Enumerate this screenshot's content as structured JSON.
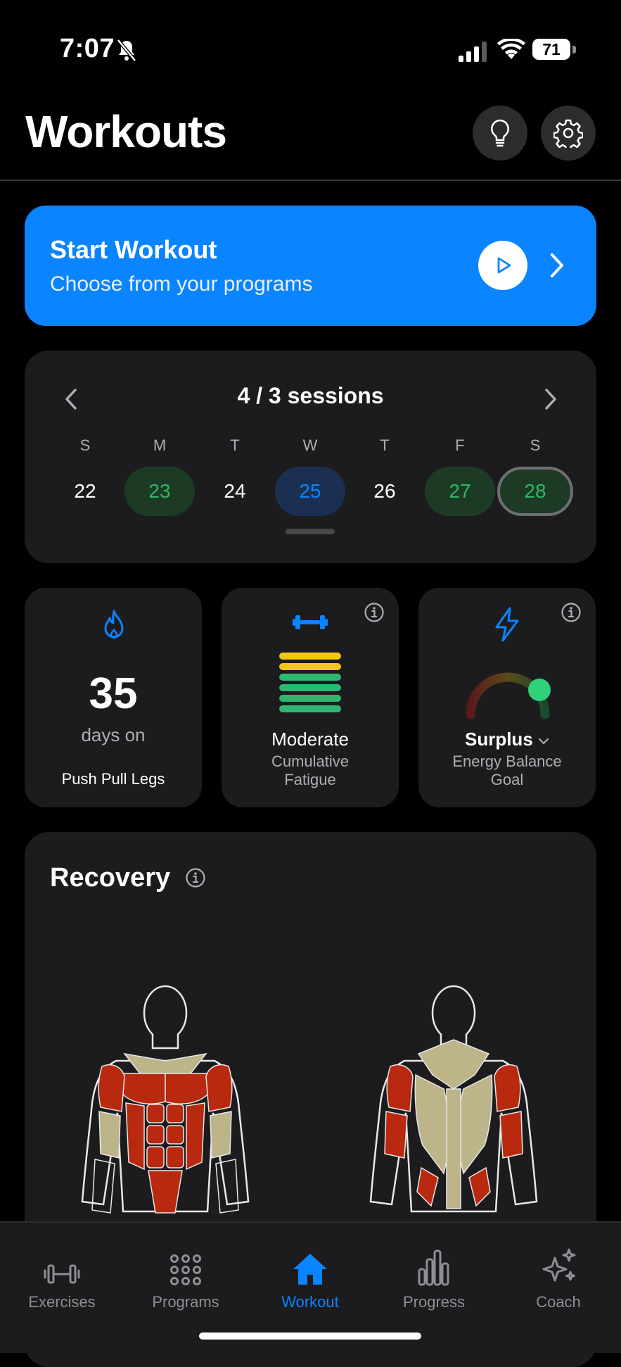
{
  "status": {
    "time": "7:07",
    "battery": "71"
  },
  "header": {
    "title": "Workouts"
  },
  "start_workout": {
    "title": "Start Workout",
    "subtitle": "Choose from your programs"
  },
  "calendar": {
    "title": "4 / 3 sessions",
    "weekdays": [
      "S",
      "M",
      "T",
      "W",
      "T",
      "F",
      "S"
    ],
    "days": [
      {
        "num": "22",
        "state": "none"
      },
      {
        "num": "23",
        "state": "completed"
      },
      {
        "num": "24",
        "state": "none"
      },
      {
        "num": "25",
        "state": "scheduled"
      },
      {
        "num": "26",
        "state": "none"
      },
      {
        "num": "27",
        "state": "completed"
      },
      {
        "num": "28",
        "state": "today-completed"
      }
    ]
  },
  "stats": {
    "streak": {
      "value": "35",
      "label": "days on",
      "program": "Push Pull Legs"
    },
    "fatigue": {
      "level": "Moderate",
      "label": "Cumulative Fatigue",
      "bar_colors": [
        "#f5c518",
        "#f5c518",
        "#2fb772",
        "#2fb772",
        "#2fb772",
        "#2fb772"
      ]
    },
    "energy": {
      "value": "Surplus",
      "label": "Energy Balance Goal"
    }
  },
  "recovery": {
    "title": "Recovery"
  },
  "tabs": [
    {
      "label": "Exercises",
      "icon": "dumbbell-icon"
    },
    {
      "label": "Programs",
      "icon": "grid-dots-icon"
    },
    {
      "label": "Workout",
      "icon": "home-icon",
      "active": true
    },
    {
      "label": "Progress",
      "icon": "bar-chart-icon"
    },
    {
      "label": "Coach",
      "icon": "sparkles-icon"
    }
  ],
  "colors": {
    "accent": "#0a84ff",
    "success": "#2fb760",
    "card": "#1c1c1e",
    "muscle_fatigued": "#b8290f",
    "muscle_recovered": "#bdb48a"
  }
}
